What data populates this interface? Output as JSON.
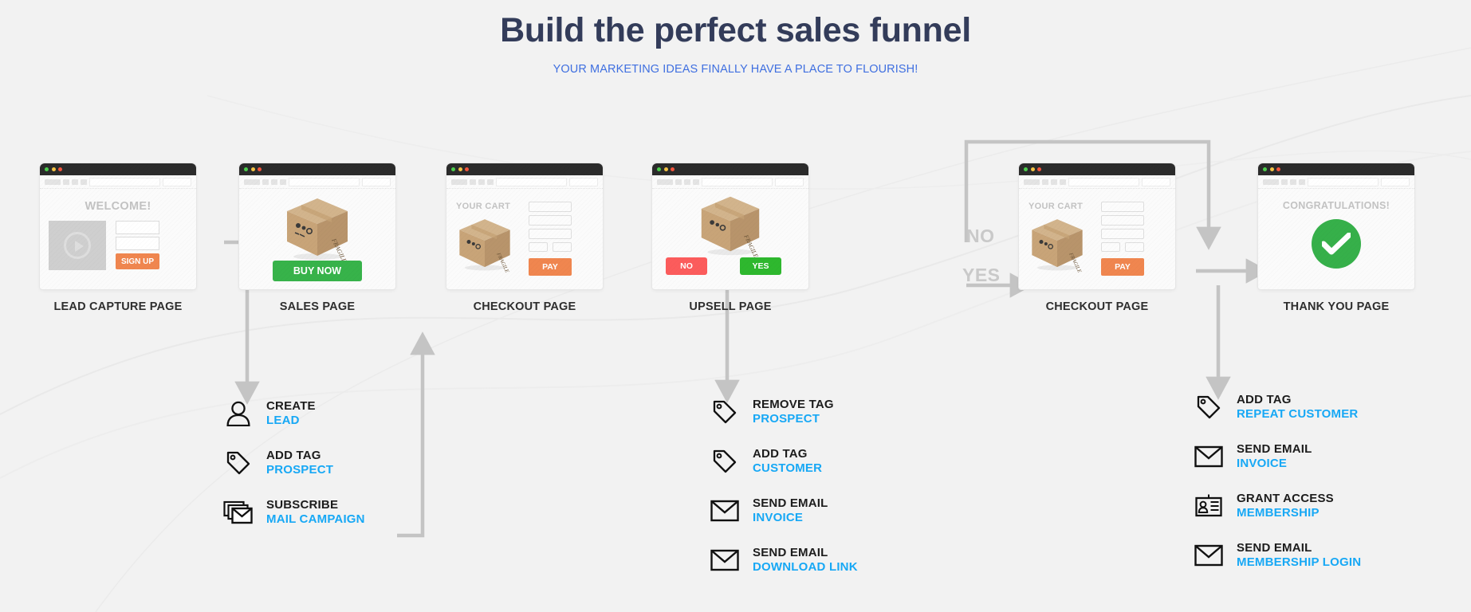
{
  "header": {
    "title": "Build the perfect sales funnel",
    "subtitle": "YOUR MARKETING IDEAS FINALLY HAVE A PLACE TO FLOURISH!"
  },
  "colors": {
    "title": "#333c5a",
    "subtitle": "#3f6fe0",
    "accent_blue": "#17a8f5",
    "orange": "#f0864f",
    "green": "#37b34a",
    "red": "#fc5c5c",
    "yes_green": "#2eb82e",
    "background": "#f2f2f2",
    "arrow_gray": "#c4c4c4"
  },
  "steps": [
    {
      "caption": "LEAD CAPTURE PAGE",
      "headline": "WELCOME!",
      "buttons": [
        {
          "label": "SIGN UP",
          "color": "#f0864f"
        }
      ],
      "elements": [
        "video-placeholder",
        "play-icon",
        "input-field",
        "input-field"
      ]
    },
    {
      "caption": "SALES PAGE",
      "headline": "",
      "buttons": [
        {
          "label": "BUY NOW",
          "color": "#37b34a"
        }
      ],
      "elements": [
        "product-box-icon"
      ]
    },
    {
      "caption": "CHECKOUT PAGE",
      "headline": "YOUR CART",
      "buttons": [
        {
          "label": "PAY",
          "color": "#f0864f"
        }
      ],
      "elements": [
        "product-box-icon",
        "cart-form-rows"
      ]
    },
    {
      "caption": "UPSELL PAGE",
      "headline": "",
      "buttons": [
        {
          "label": "NO",
          "color": "#fc5c5c"
        },
        {
          "label": "YES",
          "color": "#2eb82e"
        }
      ],
      "elements": [
        "product-box-icon"
      ]
    },
    {
      "caption": "CHECKOUT PAGE",
      "headline": "YOUR CART",
      "buttons": [
        {
          "label": "PAY",
          "color": "#f0864f"
        }
      ],
      "elements": [
        "product-box-icon",
        "cart-form-rows"
      ]
    },
    {
      "caption": "THANK YOU PAGE",
      "headline": "CONGRATULATIONS!",
      "buttons": [],
      "elements": [
        "success-check-icon"
      ]
    }
  ],
  "branch_labels": {
    "no": "NO",
    "yes": "YES"
  },
  "box_label": "FRAGILE",
  "action_columns": [
    {
      "id": "lead-capture-actions",
      "items": [
        {
          "icon": "user-icon",
          "action": "CREATE",
          "target": "LEAD"
        },
        {
          "icon": "tag-icon",
          "action": "ADD TAG",
          "target": "PROSPECT"
        },
        {
          "icon": "mail-stack-icon",
          "action": "SUBSCRIBE",
          "target": "MAIL CAMPAIGN"
        }
      ]
    },
    {
      "id": "checkout-actions",
      "items": [
        {
          "icon": "tag-icon",
          "action": "REMOVE TAG",
          "target": "PROSPECT"
        },
        {
          "icon": "tag-icon",
          "action": "ADD TAG",
          "target": "CUSTOMER"
        },
        {
          "icon": "envelope-icon",
          "action": "SEND EMAIL",
          "target": "INVOICE"
        },
        {
          "icon": "envelope-icon",
          "action": "SEND EMAIL",
          "target": "DOWNLOAD LINK"
        }
      ]
    },
    {
      "id": "thank-you-actions",
      "items": [
        {
          "icon": "tag-icon",
          "action": "ADD TAG",
          "target": "REPEAT CUSTOMER"
        },
        {
          "icon": "envelope-icon",
          "action": "SEND EMAIL",
          "target": "INVOICE"
        },
        {
          "icon": "id-card-icon",
          "action": "GRANT ACCESS",
          "target": "MEMBERSHIP"
        },
        {
          "icon": "envelope-icon",
          "action": "SEND EMAIL",
          "target": "MEMBERSHIP LOGIN"
        }
      ]
    }
  ]
}
